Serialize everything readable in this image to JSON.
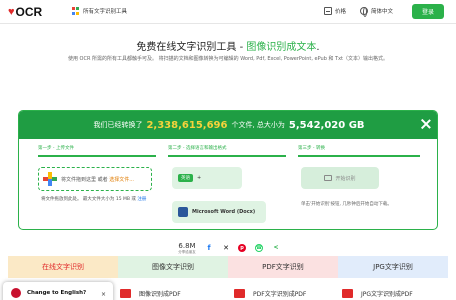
{
  "header": {
    "logo_text": "OCR",
    "apps_label": "所有文字识别工具",
    "pricing_label": "价格",
    "language_label": "简体中文",
    "login_label": "登录"
  },
  "hero": {
    "title_prefix": "免费在线文字识别工具 - ",
    "title_highlight": "图像识别成文本",
    "title_suffix": ".",
    "subtitle": "使用 OCR 所需的所有工具都触手可及。 将扫描的文档和图像转换为可编辑的 Word, Pdf, Excel, PowerPoint, ePub 和 Txt（文本）输出格式。"
  },
  "banner": {
    "prefix": "我们已经转换了",
    "count": "2,338,615,696",
    "middle": "个文件, 总大小为",
    "size": "5,542,020 GB"
  },
  "steps": {
    "step1": "第一步 - 上传文件",
    "step2": "第二步 - 选择语言和输出格式",
    "step3": "第三步 - 转换"
  },
  "upload": {
    "drop_text": "将文件拖到这里 或者 ",
    "choose_text": "选择文件...",
    "hint_text": "将文件拖放到此处。 最大文件大小为 15 MB 或 ",
    "hint_link": "注册"
  },
  "language": {
    "tag": "英语",
    "add": "+"
  },
  "format": {
    "label": "Microsoft Word (Docx)"
  },
  "convert": {
    "button_label": "开始识别",
    "hint": "单击'开始识别'按钮, 几秒钟后开始自动下载。"
  },
  "stats": {
    "count": "6.8M",
    "label": "分享给朋友"
  },
  "share_icons": [
    "facebook-icon",
    "twitter-x-icon",
    "pinterest-icon",
    "whatsapp-icon",
    "share-icon"
  ],
  "tabs": [
    {
      "label": "在线文字识别"
    },
    {
      "label": "图像文字识别"
    },
    {
      "label": "PDF文字识别"
    },
    {
      "label": "JPG文字识别"
    }
  ],
  "bottom_items": [
    {
      "label": "图像识别成PDF"
    },
    {
      "label": "PDF文字识别成PDF"
    },
    {
      "label": "JPG文字识别成PDF"
    }
  ],
  "popup": {
    "title": "Change to English?",
    "close": "×"
  },
  "colors": {
    "accent": "#2bb14a",
    "banner": "#1f9d43",
    "highlight": "#f7d33b"
  }
}
